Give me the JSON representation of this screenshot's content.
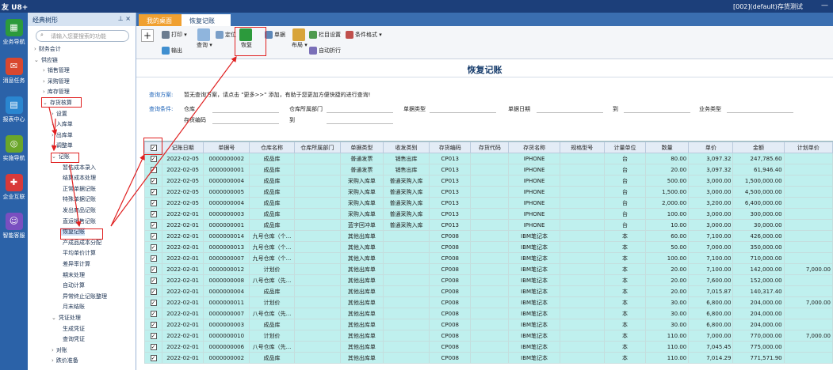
{
  "titlebar": {
    "app": "友 U8+",
    "account": "[002](default)存货测试",
    "min": "—"
  },
  "leftbar": [
    {
      "label": "业务导航",
      "color": "#2c9a3c",
      "glyph": "▦"
    },
    {
      "label": "消息任务",
      "color": "#d8472f",
      "glyph": "✉"
    },
    {
      "label": "报表中心",
      "color": "#2a86d0",
      "glyph": "▤"
    },
    {
      "label": "实施导航",
      "color": "#6aa62a",
      "glyph": "◎"
    },
    {
      "label": "企业互联",
      "color": "#d83a3a",
      "glyph": "✚"
    },
    {
      "label": "智能客服",
      "color": "#7a4fc0",
      "glyph": "☺"
    }
  ],
  "nav": {
    "title": "经典树形",
    "tools": "⊥ ×",
    "search_placeholder": "请输入您要搜索的功能",
    "items": [
      {
        "label": "财务会计",
        "level": 0,
        "arr": "›"
      },
      {
        "label": "供应链",
        "level": 0,
        "arr": "⌄"
      },
      {
        "label": "销售管理",
        "level": 1,
        "arr": "›"
      },
      {
        "label": "采购管理",
        "level": 1,
        "arr": "›"
      },
      {
        "label": "库存管理",
        "level": 1,
        "arr": "›"
      },
      {
        "label": "存货核算",
        "level": 1,
        "arr": "⌄"
      },
      {
        "label": "设置",
        "level": 2,
        "arr": "›"
      },
      {
        "label": "入库单",
        "level": 2,
        "arr": "›"
      },
      {
        "label": "出库单",
        "level": 2,
        "arr": "›"
      },
      {
        "label": "调整单",
        "level": 2,
        "arr": "›"
      },
      {
        "label": "记账",
        "level": 2,
        "arr": "⌄"
      },
      {
        "label": "暂估成本录入",
        "level": 3,
        "arr": ""
      },
      {
        "label": "结算成本处理",
        "level": 3,
        "arr": ""
      },
      {
        "label": "正常单据记账",
        "level": 3,
        "arr": ""
      },
      {
        "label": "特殊单据记账",
        "level": 3,
        "arr": ""
      },
      {
        "label": "发出商品记账",
        "level": 3,
        "arr": ""
      },
      {
        "label": "直运销售记账",
        "level": 3,
        "arr": ""
      },
      {
        "label": "恢复记账",
        "level": 3,
        "arr": ""
      },
      {
        "label": "产成品成本分配",
        "level": 3,
        "arr": ""
      },
      {
        "label": "平均单价计算",
        "level": 3,
        "arr": ""
      },
      {
        "label": "差异率计算",
        "level": 3,
        "arr": ""
      },
      {
        "label": "期末处理",
        "level": 3,
        "arr": ""
      },
      {
        "label": "自动计算",
        "level": 3,
        "arr": ""
      },
      {
        "label": "异常终止记账整理",
        "level": 3,
        "arr": ""
      },
      {
        "label": "月末结账",
        "level": 3,
        "arr": ""
      },
      {
        "label": "凭证处理",
        "level": 2,
        "arr": "⌄"
      },
      {
        "label": "生成凭证",
        "level": 3,
        "arr": ""
      },
      {
        "label": "查询凭证",
        "level": 3,
        "arr": ""
      },
      {
        "label": "对账",
        "level": 2,
        "arr": "›"
      },
      {
        "label": "跌价准备",
        "level": 2,
        "arr": "›"
      }
    ]
  },
  "tabs": [
    {
      "label": "我的桌面"
    },
    {
      "label": "恢复记账",
      "close": "×"
    }
  ],
  "toolbar": {
    "add": "+",
    "print": "打印",
    "export": "输出",
    "query": "查询",
    "locate": "定位",
    "restore": "恢复",
    "doc": "单据",
    "layout": "布局",
    "colset": "栏目设置",
    "format": "条件格式",
    "autoline": "自动折行"
  },
  "page_title": "恢复记账",
  "query": {
    "plan_label": "查询方案:",
    "plan_msg": "暂无查询方案，请点击 \"更多>>\" 添加，有助于您更加方便快捷的进行查询!",
    "cond_label": "查询条件:",
    "warehouse": "仓库",
    "dept": "仓库所属部门",
    "doctype": "单据类型",
    "docdate": "单据日期",
    "to1": "到",
    "biztype": "业务类型",
    "invcode": "存货编码",
    "to2": "到"
  },
  "grid": {
    "headers": [
      "",
      "记账日期",
      "单据号",
      "仓库名称",
      "仓库所属部门",
      "单据类型",
      "收发类别",
      "存货编码",
      "存货代码",
      "存货名称",
      "规格型号",
      "计量单位",
      "数量",
      "单价",
      "金额",
      "计划单价"
    ],
    "rows": [
      [
        "2022-02-05",
        "0000000002",
        "成品库",
        "",
        "普通发票",
        "销售出库",
        "CP013",
        "",
        "IPHONE",
        "",
        "台",
        "80.00",
        "3,097.32",
        "247,785.60",
        ""
      ],
      [
        "2022-02-05",
        "0000000001",
        "成品库",
        "",
        "普通发票",
        "销售出库",
        "CP013",
        "",
        "IPHONE",
        "",
        "台",
        "20.00",
        "3,097.32",
        "61,946.40",
        ""
      ],
      [
        "2022-02-05",
        "0000000004",
        "成品库",
        "",
        "采购入库单",
        "普通采购入库",
        "CP013",
        "",
        "IPHONE",
        "",
        "台",
        "500.00",
        "3,000.00",
        "1,500,000.00",
        ""
      ],
      [
        "2022-02-05",
        "0000000005",
        "成品库",
        "",
        "采购入库单",
        "普通采购入库",
        "CP013",
        "",
        "IPHONE",
        "",
        "台",
        "1,500.00",
        "3,000.00",
        "4,500,000.00",
        ""
      ],
      [
        "2022-02-05",
        "0000000004",
        "成品库",
        "",
        "采购入库单",
        "普通采购入库",
        "CP013",
        "",
        "IPHONE",
        "",
        "台",
        "2,000.00",
        "3,200.00",
        "6,400,000.00",
        ""
      ],
      [
        "2022-02-01",
        "0000000003",
        "成品库",
        "",
        "采购入库单",
        "普通采购入库",
        "CP013",
        "",
        "IPHONE",
        "",
        "台",
        "100.00",
        "3,000.00",
        "300,000.00",
        ""
      ],
      [
        "2022-02-01",
        "0000000001",
        "成品库",
        "",
        "蓝字回冲单",
        "普通采购入库",
        "CP013",
        "",
        "IPHONE",
        "",
        "台",
        "10.00",
        "3,000.00",
        "30,000.00",
        ""
      ],
      [
        "2022-02-01",
        "0000000014",
        "九号仓库（个...",
        "",
        "其他出库单",
        "",
        "CP008",
        "",
        "IBM笔记本",
        "",
        "本",
        "60.00",
        "7,100.00",
        "426,000.00",
        ""
      ],
      [
        "2022-02-01",
        "0000000013",
        "九号仓库（个...",
        "",
        "其他入库单",
        "",
        "CP008",
        "",
        "IBM笔记本",
        "",
        "本",
        "50.00",
        "7,000.00",
        "350,000.00",
        ""
      ],
      [
        "2022-02-01",
        "0000000007",
        "九号仓库（个...",
        "",
        "其他入库单",
        "",
        "CP008",
        "",
        "IBM笔记本",
        "",
        "本",
        "100.00",
        "7,100.00",
        "710,000.00",
        ""
      ],
      [
        "2022-02-01",
        "0000000012",
        "计划价",
        "",
        "其他出库单",
        "",
        "CP008",
        "",
        "IBM笔记本",
        "",
        "本",
        "20.00",
        "7,100.00",
        "142,000.00",
        "7,000.00"
      ],
      [
        "2022-02-01",
        "0000000008",
        "八号仓库（先...",
        "",
        "其他出库单",
        "",
        "CP008",
        "",
        "IBM笔记本",
        "",
        "本",
        "20.00",
        "7,600.00",
        "152,000.00",
        ""
      ],
      [
        "2022-02-01",
        "0000000004",
        "成品库",
        "",
        "其他出库单",
        "",
        "CP008",
        "",
        "IBM笔记本",
        "",
        "本",
        "20.00",
        "7,015.87",
        "140,317.40",
        ""
      ],
      [
        "2022-02-01",
        "0000000011",
        "计划价",
        "",
        "其他出库单",
        "",
        "CP008",
        "",
        "IBM笔记本",
        "",
        "本",
        "30.00",
        "6,800.00",
        "204,000.00",
        "7,000.00"
      ],
      [
        "2022-02-01",
        "0000000007",
        "八号仓库（先...",
        "",
        "其他出库单",
        "",
        "CP008",
        "",
        "IBM笔记本",
        "",
        "本",
        "30.00",
        "6,800.00",
        "204,000.00",
        ""
      ],
      [
        "2022-02-01",
        "0000000003",
        "成品库",
        "",
        "其他出库单",
        "",
        "CP008",
        "",
        "IBM笔记本",
        "",
        "本",
        "30.00",
        "6,800.00",
        "204,000.00",
        ""
      ],
      [
        "2022-02-01",
        "0000000010",
        "计划价",
        "",
        "其他出库单",
        "",
        "CP008",
        "",
        "IBM笔记本",
        "",
        "本",
        "110.00",
        "7,000.00",
        "770,000.00",
        "7,000.00"
      ],
      [
        "2022-02-01",
        "0000000006",
        "八号仓库（先...",
        "",
        "其他出库单",
        "",
        "CP008",
        "",
        "IBM笔记本",
        "",
        "本",
        "110.00",
        "7,045.45",
        "775,000.00",
        ""
      ],
      [
        "2022-02-01",
        "0000000002",
        "成品库",
        "",
        "其他出库单",
        "",
        "CP008",
        "",
        "IBM笔记本",
        "",
        "本",
        "110.00",
        "7,014.29",
        "771,571.90",
        ""
      ]
    ]
  }
}
